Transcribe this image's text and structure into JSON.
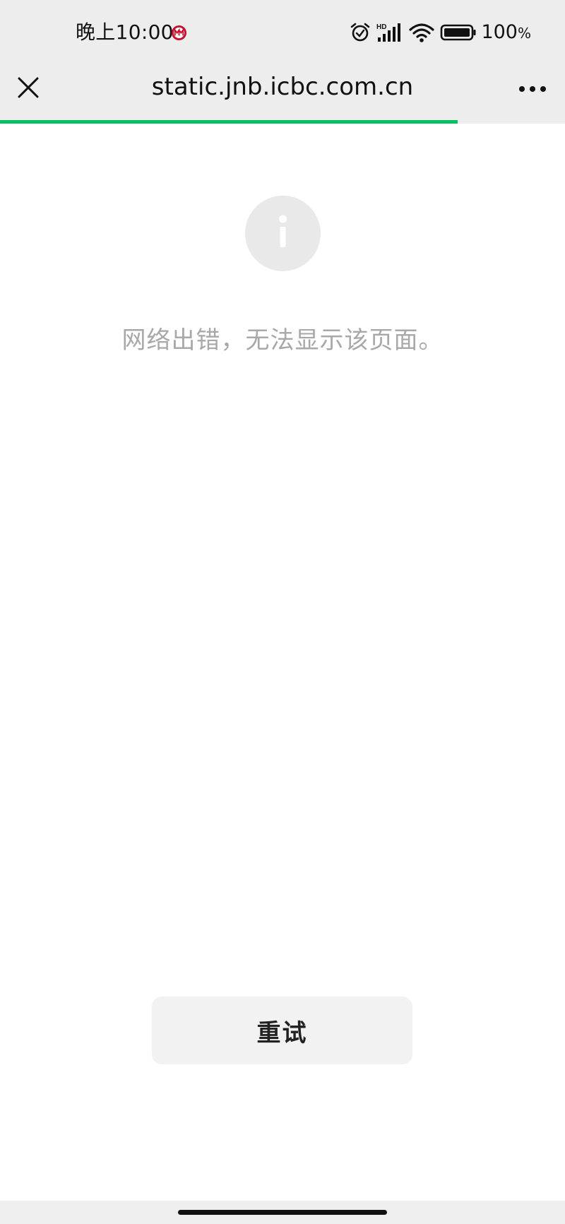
{
  "status_bar": {
    "time": "晚上10:00",
    "battery_level": "100",
    "battery_unit": "%",
    "icons": [
      "app-notification-icon",
      "alarm-icon",
      "hd-signal-icon",
      "wifi-icon",
      "battery-icon"
    ]
  },
  "nav": {
    "title": "static.jnb.icbc.com.cn",
    "close_icon": "close-icon",
    "more_icon": "more-icon",
    "load_progress": 0.81
  },
  "content": {
    "icon": "info-icon",
    "error_message": "网络出错，无法显示该页面。",
    "retry_label": "重试"
  },
  "colors": {
    "progress": "#07c160",
    "header_bg": "#ededed",
    "error_text": "#a8a8a8"
  }
}
